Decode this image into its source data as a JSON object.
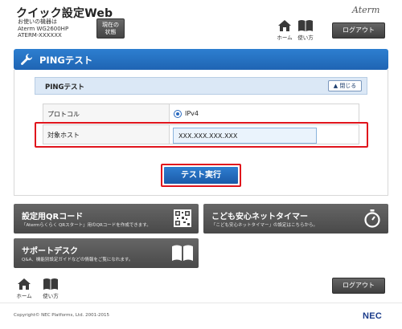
{
  "header": {
    "app_title": "クイック設定Web",
    "device_line1": "お使いの機器は",
    "device_line2": "Aterm WG2600HP",
    "device_line3": "ATERM-XXXXXX",
    "status_line1": "現在の",
    "status_line2": "状態",
    "brand": "Aterm",
    "home_label": "ホーム",
    "guide_label": "使い方",
    "logout_label": "ログアウト"
  },
  "title_bar": {
    "title": "PINGテスト"
  },
  "section": {
    "title": "PINGテスト",
    "close_label": "閉じる"
  },
  "form": {
    "protocol_label": "プロトコル",
    "protocol_value": "IPv4",
    "host_label": "対象ホスト",
    "host_value": "XXX.XXX.XXX.XXX"
  },
  "test_button": "テスト実行",
  "cards": {
    "qr_title": "設定用QRコード",
    "qr_desc": "「Atermらくらく QRスタート」用のQRコードを作成できます。",
    "timer_title": "こども安心ネットタイマー",
    "timer_desc": "「こども安心ネットタイマー」の設定はこちらから。",
    "support_title": "サポートデスク",
    "support_desc": "Q&A、機能別設定ガイドなどの情報をご覧になれます。"
  },
  "footer": {
    "home_label": "ホーム",
    "guide_label": "使い方",
    "logout_label": "ログアウト",
    "copyright": "Copyright© NEC Platforms, Ltd. 2001-2015",
    "brand": "NEC"
  },
  "colors": {
    "accent_blue": "#1f64b3",
    "highlight_red": "#e0141c",
    "card_dark": "#555555"
  }
}
